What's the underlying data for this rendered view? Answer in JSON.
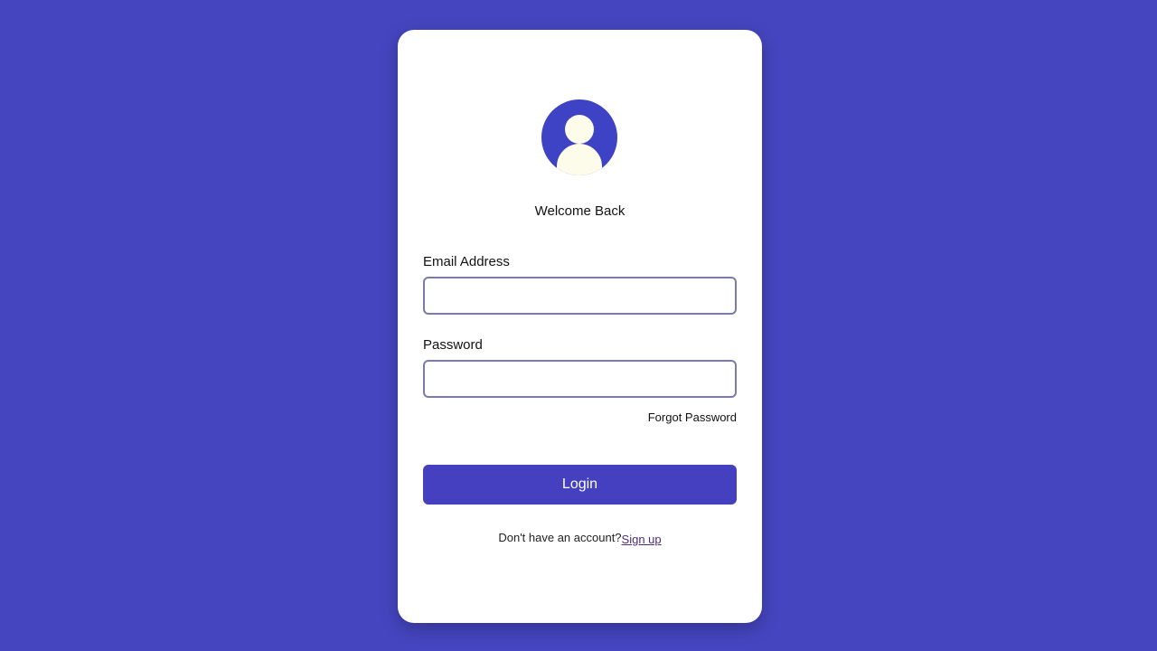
{
  "colors": {
    "background": "#4545bf",
    "card": "#ffffff",
    "accent": "#4540c0",
    "avatar_bg": "#3d43c4",
    "avatar_fg": "#fdfbea"
  },
  "avatar": {
    "icon": "user-icon"
  },
  "heading": "Welcome Back",
  "email": {
    "label": "Email Address",
    "value": "",
    "placeholder": ""
  },
  "password": {
    "label": "Password",
    "value": "",
    "placeholder": ""
  },
  "forgot_password": "Forgot Password",
  "login_button": "Login",
  "signup": {
    "prompt": "Don't have an account?",
    "link": "Sign up"
  }
}
